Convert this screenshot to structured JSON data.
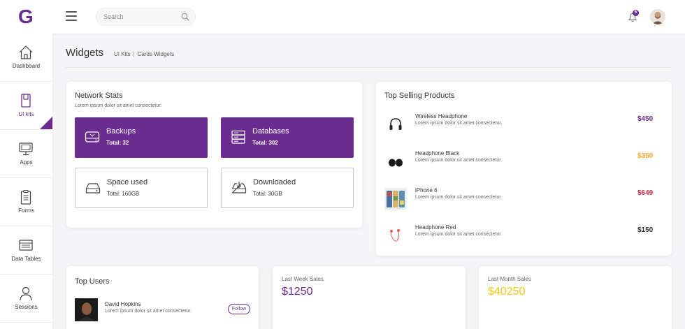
{
  "brand": {
    "logo_letter": "G",
    "accent": "#6a2c91"
  },
  "header": {
    "search_placeholder": "Search",
    "notification_count": "5"
  },
  "sidebar": {
    "items": [
      {
        "label": "Dashboard",
        "icon": "home-icon"
      },
      {
        "label": "UI kits",
        "icon": "book-icon",
        "active": true
      },
      {
        "label": "Apps",
        "icon": "monitor-icon"
      },
      {
        "label": "Forms",
        "icon": "clipboard-icon"
      },
      {
        "label": "Data Tables",
        "icon": "table-icon"
      },
      {
        "label": "Sessions",
        "icon": "user-icon"
      }
    ]
  },
  "page": {
    "title": "Widgets",
    "breadcrumb": [
      "UI Kits",
      "Cards Widgets"
    ]
  },
  "network_stats": {
    "title": "Network Stats",
    "subtitle": "Lorem ipsum dolor sit amet consectetur.",
    "tiles": [
      {
        "label": "Backups",
        "total": "Total: 32",
        "icon": "hard-drive-icon",
        "style": "filled"
      },
      {
        "label": "Databases",
        "total": "Total: 302",
        "icon": "server-icon",
        "style": "filled"
      },
      {
        "label": "Space used",
        "total": "Total: 160GB",
        "icon": "hard-drive-icon",
        "style": "outline"
      },
      {
        "label": "Downloaded",
        "total": "Total: 30GB",
        "icon": "download-icon",
        "style": "outline"
      }
    ]
  },
  "top_products": {
    "title": "Top Selling Products",
    "items": [
      {
        "name": "Wireless Headphone",
        "desc": "Lorem ipsum dolor sit amet consectetur.",
        "price": "$450",
        "price_color": "#6a2c91",
        "icon": "headphone-icon"
      },
      {
        "name": "Headphone Black",
        "desc": "Lorem ipsum dolor sit amet consectetur.",
        "price": "$350",
        "price_color": "#f5a623",
        "icon": "earbuds-icon"
      },
      {
        "name": "iPhone 6",
        "desc": "Lorem ipsum dolor sit amet consectetur.",
        "price": "$649",
        "price_color": "#d32f4a",
        "icon": "phone-icon"
      },
      {
        "name": "Headphone Red",
        "desc": "Lorem ipsum dolor sit amet consectetur.",
        "price": "$150",
        "price_color": "#333333",
        "icon": "earphone-icon"
      }
    ]
  },
  "top_users": {
    "title": "Top Users",
    "users": [
      {
        "name": "David Hopkins",
        "desc": "Lorem ipsum dolor sit amet consectetur.",
        "action": "Follow"
      }
    ]
  },
  "sales": [
    {
      "label": "Last Week Sales",
      "value": "$1250",
      "color": "#6a2c91"
    },
    {
      "label": "Last Month Sales",
      "value": "$40250",
      "color": "#f5c518"
    }
  ]
}
